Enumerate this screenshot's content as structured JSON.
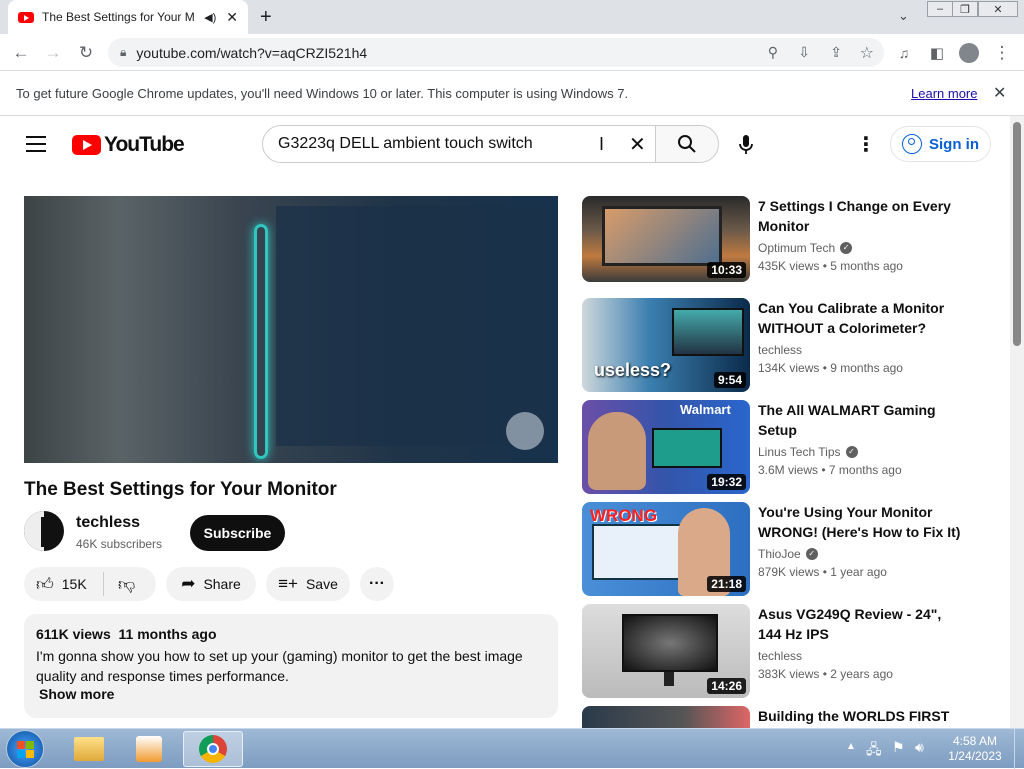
{
  "browser": {
    "tab_title": "The Best Settings for Your M",
    "url": "youtube.com/watch?v=aqCRZI521h4",
    "infobar_text": "To get future Google Chrome updates, you'll need Windows 10 or later. This computer is using Windows 7.",
    "infobar_link": "Learn more"
  },
  "youtube": {
    "logo_text": "YouTube",
    "search_value": "G3223q DELL ambient touch switch",
    "sign_in": "Sign in"
  },
  "video": {
    "title": "The Best Settings for Your Monitor",
    "channel": "techless",
    "subscribers": "46K subscribers",
    "subscribe_label": "Subscribe",
    "likes": "15K",
    "share_label": "Share",
    "save_label": "Save",
    "views": "611K views",
    "age": "11 months ago",
    "description": "I'm gonna show you how to set up your (gaming) monitor to get the best image quality and response times performance.",
    "show_more": "Show more"
  },
  "recommendations": [
    {
      "title": "7 Settings I Change on Every Monitor",
      "channel": "Optimum Tech",
      "verified": true,
      "views": "435K views",
      "age": "5 months ago",
      "duration": "10:33"
    },
    {
      "title": "Can You Calibrate a Monitor WITHOUT a Colorimeter?",
      "channel": "techless",
      "verified": false,
      "views": "134K views",
      "age": "9 months ago",
      "duration": "9:54",
      "thumb_text": "useless?"
    },
    {
      "title": "The All WALMART Gaming Setup",
      "channel": "Linus Tech Tips",
      "verified": true,
      "views": "3.6M views",
      "age": "7 months ago",
      "duration": "19:32",
      "thumb_text": "Walmart"
    },
    {
      "title": "You're Using Your Monitor WRONG! (Here's How to Fix It)",
      "channel": "ThioJoe",
      "verified": true,
      "views": "879K views",
      "age": "1 year ago",
      "duration": "21:18",
      "thumb_text": "WRONG"
    },
    {
      "title": "Asus VG249Q Review - 24\", 144 Hz IPS",
      "channel": "techless",
      "verified": false,
      "views": "383K views",
      "age": "2 years ago",
      "duration": "14:26"
    },
    {
      "title": "Building the WORLDS FIRST"
    }
  ],
  "taskbar": {
    "time": "4:58 AM",
    "date": "1/24/2023"
  },
  "colors": {
    "youtube_red": "#ff0000",
    "link_blue": "#065fd4",
    "chrome_tabstrip": "#dee1e6"
  }
}
